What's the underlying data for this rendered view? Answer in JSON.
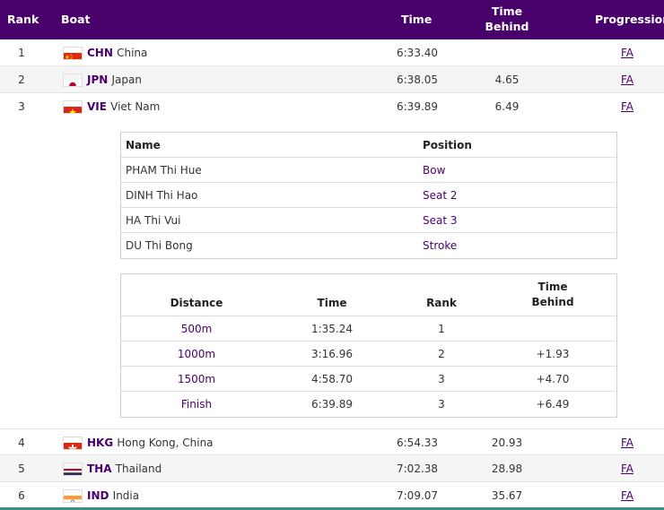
{
  "header": {
    "rank": "Rank",
    "boat": "Boat",
    "time": "Time",
    "time_behind_1": "Time",
    "time_behind_2": "Behind",
    "progression": "Progression"
  },
  "rows_top": [
    {
      "rank": "1",
      "code": "CHN",
      "country": "China",
      "time": "6:33.40",
      "behind": "",
      "progression": "FA",
      "flag": "cn"
    },
    {
      "rank": "2",
      "code": "JPN",
      "country": "Japan",
      "time": "6:38.05",
      "behind": "4.65",
      "progression": "FA",
      "flag": "jp"
    },
    {
      "rank": "3",
      "code": "VIE",
      "country": "Viet Nam",
      "time": "6:39.89",
      "behind": "6.49",
      "progression": "FA",
      "flag": "vn"
    }
  ],
  "crew": {
    "name_header": "Name",
    "position_header": "Position",
    "members": [
      {
        "name": "PHAM Thi Hue",
        "position": "Bow"
      },
      {
        "name": "DINH Thi Hao",
        "position": "Seat 2"
      },
      {
        "name": "HA Thi Vui",
        "position": "Seat 3"
      },
      {
        "name": "DU Thi Bong",
        "position": "Stroke"
      }
    ]
  },
  "splits": {
    "distance_header": "Distance",
    "time_header": "Time",
    "rank_header": "Rank",
    "behind_header_1": "Time",
    "behind_header_2": "Behind",
    "rows": [
      {
        "distance": "500m",
        "time": "1:35.24",
        "rank": "1",
        "behind": ""
      },
      {
        "distance": "1000m",
        "time": "3:16.96",
        "rank": "2",
        "behind": "+1.93"
      },
      {
        "distance": "1500m",
        "time": "4:58.70",
        "rank": "3",
        "behind": "+4.70"
      },
      {
        "distance": "Finish",
        "time": "6:39.89",
        "rank": "3",
        "behind": "+6.49"
      }
    ]
  },
  "rows_bottom": [
    {
      "rank": "4",
      "code": "HKG",
      "country": "Hong Kong, China",
      "time": "6:54.33",
      "behind": "20.93",
      "progression": "FA",
      "flag": "hk"
    },
    {
      "rank": "5",
      "code": "THA",
      "country": "Thailand",
      "time": "7:02.38",
      "behind": "28.98",
      "progression": "FA",
      "flag": "th"
    },
    {
      "rank": "6",
      "code": "IND",
      "country": "India",
      "time": "7:09.07",
      "behind": "35.67",
      "progression": "FA",
      "flag": "in"
    }
  ],
  "colors": {
    "header_bg": "#48006a",
    "accent": "#48006a",
    "bottom_bar": "#3b8f86"
  }
}
